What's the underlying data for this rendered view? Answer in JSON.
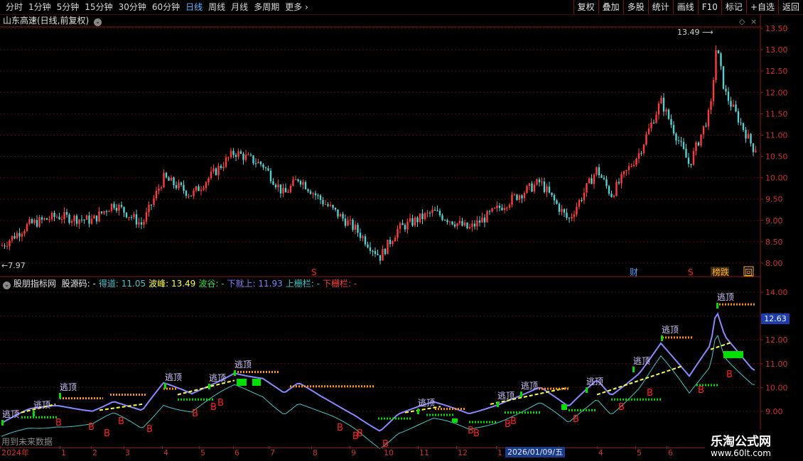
{
  "toolbar": {
    "periods": [
      "分时",
      "1分钟",
      "5分钟",
      "15分钟",
      "30分钟",
      "60分钟",
      "日线",
      "周线",
      "月线",
      "多周期",
      "更多"
    ],
    "active_period": "日线",
    "buttons": [
      "复权",
      "叠加",
      "多股",
      "统计",
      "画线",
      "F10",
      "标记",
      "+自选",
      "返回"
    ]
  },
  "main_chart": {
    "title": "山东高速(日线,前复权)",
    "high_label": "13.49",
    "low_label": "7.97",
    "y_ticks": [
      "13.50",
      "13.00",
      "12.50",
      "12.00",
      "11.50",
      "11.00",
      "10.50",
      "10.00",
      "9.50",
      "9.00",
      "8.50",
      "8.00"
    ],
    "markers": {
      "s1": "S",
      "s2": "S",
      "cai": "财",
      "bang": "榜",
      "die": "跌",
      "hui": "回"
    }
  },
  "indicator": {
    "name": "股朋指标网",
    "items": [
      {
        "label": "股源码:",
        "value": "-",
        "color": "#e8e8e8"
      },
      {
        "label": "得道:",
        "value": "11.05",
        "color": "#40c8c8"
      },
      {
        "label": "波峰:",
        "value": "13.49",
        "color": "#ffff40"
      },
      {
        "label": "波谷:",
        "value": "-",
        "color": "#40e040"
      },
      {
        "label": "下就上:",
        "value": "11.93",
        "color": "#8080ff"
      },
      {
        "label": "上栅栏:",
        "value": "-",
        "color": "#40c8c8"
      },
      {
        "label": "下栅栏:",
        "value": "-",
        "color": "#ff4040"
      }
    ],
    "y_ticks": [
      "14.00",
      "13.00",
      "12.00",
      "11.00",
      "10.00",
      "9.00"
    ],
    "current_price": "12.63",
    "footer_note": "用到未来数据",
    "escape_label": "逃顶",
    "buy_label": "B"
  },
  "date_axis": {
    "ticks": [
      "2024年",
      "1",
      "2",
      "3",
      "4",
      "5",
      "6",
      "7",
      "8",
      "9",
      "10",
      "11",
      "12",
      "1",
      "3",
      "4",
      "5",
      "6"
    ],
    "cursor_date": "2026/01/09/五"
  },
  "watermark": {
    "name": "乐淘公式网",
    "url": "www.60lt.com"
  },
  "colors": {
    "up": "#ff3c3c",
    "down": "#54d2d2",
    "grid": "#5a0a0a",
    "axis": "#8a1a1a",
    "blue_line": "#8888ff",
    "yellow": "#ffff40",
    "cyan": "#40c8c8",
    "green": "#00e000",
    "orange": "#ff9020",
    "red": "#ff2020"
  }
}
